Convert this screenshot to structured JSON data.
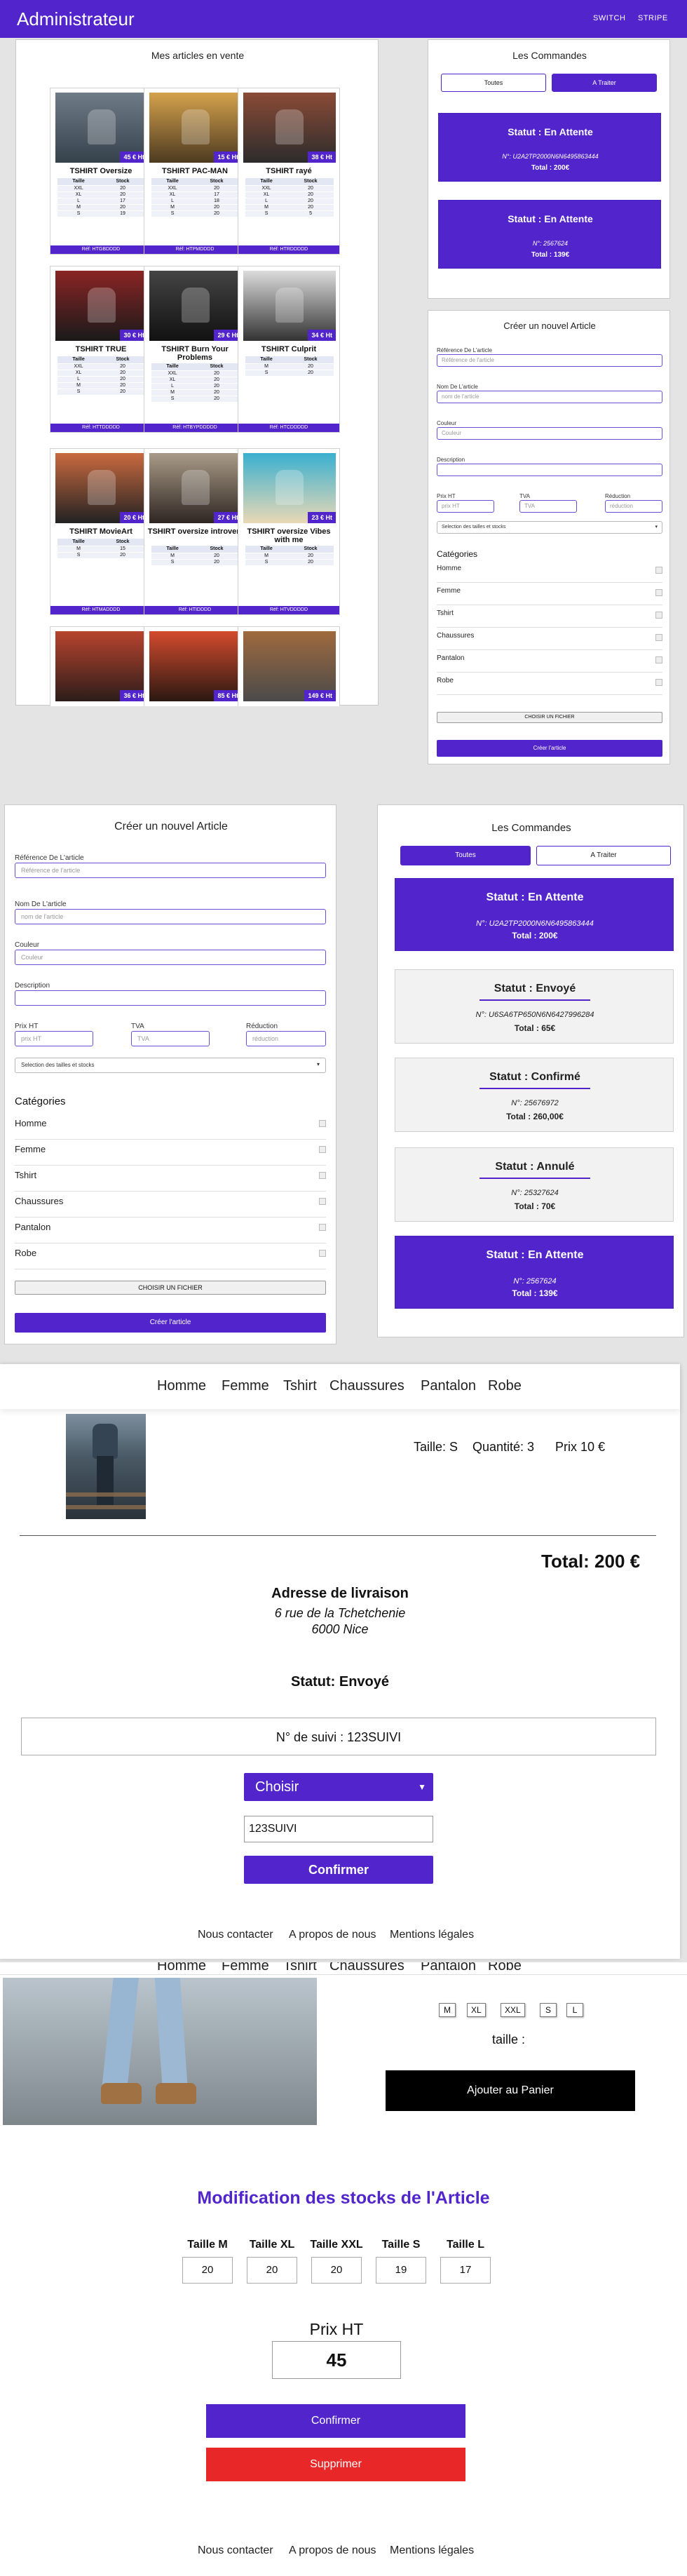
{
  "header": {
    "title": "Administrateur",
    "nav": [
      "SWITCH",
      "STRIPE"
    ],
    "colors": {
      "accent": "#5225cc"
    }
  },
  "articles_panel": {
    "title": "Mes articles en vente",
    "table_headers": [
      "Taille",
      "Stock"
    ],
    "cards": [
      {
        "name": "TSHIRT Oversize",
        "price": "45 € Ht",
        "ref": "Réf: HTGBDDDD",
        "rows": [
          [
            "XXL",
            "20"
          ],
          [
            "XL",
            "20"
          ],
          [
            "L",
            "17"
          ],
          [
            "M",
            "20"
          ],
          [
            "S",
            "19"
          ]
        ]
      },
      {
        "name": "TSHIRT PAC-MAN",
        "price": "15 € Ht",
        "ref": "Réf: HTPMDDDD",
        "rows": [
          [
            "XXL",
            "20"
          ],
          [
            "XL",
            "17"
          ],
          [
            "L",
            "18"
          ],
          [
            "M",
            "20"
          ],
          [
            "S",
            "20"
          ]
        ]
      },
      {
        "name": "TSHIRT rayé",
        "price": "38 € Ht",
        "ref": "Réf: HTRDDDDD",
        "rows": [
          [
            "XXL",
            "20"
          ],
          [
            "XL",
            "20"
          ],
          [
            "L",
            "20"
          ],
          [
            "M",
            "20"
          ],
          [
            "S",
            "5"
          ]
        ]
      },
      {
        "name": "TSHIRT TRUE",
        "price": "30 € Ht",
        "ref": "Réf: HTTDDDDD",
        "rows": [
          [
            "XXL",
            "20"
          ],
          [
            "XL",
            "20"
          ],
          [
            "L",
            "20"
          ],
          [
            "M",
            "20"
          ],
          [
            "S",
            "20"
          ]
        ]
      },
      {
        "name": "TSHIRT Burn Your Problems",
        "price": "29 € Ht",
        "ref": "Réf: HTBYPDDDDD",
        "rows": [
          [
            "XXL",
            "20"
          ],
          [
            "XL",
            "20"
          ],
          [
            "L",
            "20"
          ],
          [
            "M",
            "20"
          ],
          [
            "S",
            "20"
          ]
        ]
      },
      {
        "name": "TSHIRT Culprit",
        "price": "34 € Ht",
        "ref": "Réf: HTCDDDDD",
        "rows": [
          [
            "M",
            "20"
          ],
          [
            "S",
            "20"
          ]
        ]
      },
      {
        "name": "TSHIRT MovieArt",
        "price": "20 € Ht",
        "ref": "Réf: HTMADDDD",
        "rows": [
          [
            "M",
            "15"
          ],
          [
            "S",
            "20"
          ]
        ]
      },
      {
        "name": "TSHIRT oversize introvert",
        "price": "27 € Ht",
        "ref": "Réf: HTIDDDD",
        "rows": [
          [
            "M",
            "20"
          ],
          [
            "S",
            "20"
          ]
        ]
      },
      {
        "name": "TSHIRT oversize Vibes with me",
        "price": "23 € Ht",
        "ref": "Réf: HTVDDDDD",
        "rows": [
          [
            "M",
            "20"
          ],
          [
            "S",
            "20"
          ]
        ]
      }
    ],
    "partial_cards": [
      {
        "price": "36 € Ht"
      },
      {
        "price": "85 € Ht"
      },
      {
        "price": "149 € Ht"
      }
    ]
  },
  "orders": {
    "title": "Les Commandes",
    "tabs": [
      "Toutes",
      "A Traiter"
    ],
    "list_filtered": [
      {
        "status": "Statut : En Attente",
        "number": "N°: U2A2TP2000N6N6495863444",
        "total": "Total : 200€"
      },
      {
        "status": "Statut : En Attente",
        "number": "N°: 2567624",
        "total": "Total : 139€"
      }
    ],
    "list_all": [
      {
        "status": "Statut : En Attente",
        "number": "N°: U2A2TP2000N6N6495863444",
        "total": "Total : 200€",
        "style": "purple"
      },
      {
        "status": "Statut : Envoyé",
        "number": "N°: U6SA6TP650N6N6427996284",
        "total": "Total : 65€",
        "style": "grey"
      },
      {
        "status": "Statut : Confirmé",
        "number": "N°: 25676972",
        "total": "Total : 260,00€",
        "style": "grey"
      },
      {
        "status": "Statut : Annulé",
        "number": "N°: 25327624",
        "total": "Total : 70€",
        "style": "grey"
      },
      {
        "status": "Statut : En Attente",
        "number": "N°: 2567624",
        "total": "Total : 139€",
        "style": "purple"
      }
    ]
  },
  "create_form": {
    "title": "Créer un nouvel Article",
    "ref_label": "Référence De L'article",
    "ref_placeholder": "Référence de l'article",
    "name_label": "Nom De L'article",
    "name_placeholder": "nom de l'article",
    "color_label": "Couleur",
    "color_placeholder": "Couleur",
    "desc_label": "Description",
    "price_label": "Prix HT",
    "price_placeholder": "prix HT",
    "tva_label": "TVA",
    "tva_placeholder": "TVA",
    "discount_label": "Réduction",
    "discount_placeholder": "réduction",
    "sizes_select": "Selection des tailles et stocks",
    "categories_title": "Catégories",
    "categories": [
      "Homme",
      "Femme",
      "Tshirt",
      "Chaussures",
      "Pantalon",
      "Robe"
    ],
    "file_button": "CHOISIR UN FICHIER",
    "submit": "Créer l'article"
  },
  "order_detail": {
    "menu": [
      "Homme",
      "Femme",
      "Tshirt",
      "Chaussures",
      "Pantalon",
      "Robe"
    ],
    "item": {
      "size": "Taille: S",
      "qty": "Quantité: 3",
      "price": "Prix 10 €"
    },
    "total": "Total: 200 €",
    "address_title": "Adresse de livraison",
    "address_line1": "6 rue de la Tchetchenie",
    "address_line2": "6000 Nice",
    "status": "Statut: Envoyé",
    "tracking": "N° de suivi : 123SUIVI",
    "select": "Choisir",
    "tracking_input": "123SUIVI",
    "confirm": "Confirmer"
  },
  "footer": {
    "links": [
      "Nous contacter",
      "A propos de nous",
      "Mentions légales"
    ]
  },
  "stock_edit": {
    "menu": [
      "Homme",
      "Femme",
      "Tshirt",
      "Chaussures",
      "Pantalon",
      "Robe"
    ],
    "size_buttons": [
      "M",
      "XL",
      "XXL",
      "S",
      "L"
    ],
    "size_label": "taille :",
    "add_cart": "Ajouter au Panier",
    "title": "Modification des stocks de l'Article",
    "sizes": [
      {
        "label": "Taille M",
        "value": "20"
      },
      {
        "label": "Taille XL",
        "value": "20"
      },
      {
        "label": "Taille XXL",
        "value": "20"
      },
      {
        "label": "Taille S",
        "value": "19"
      },
      {
        "label": "Taille L",
        "value": "17"
      }
    ],
    "price_label": "Prix HT",
    "price_value": "45",
    "confirm": "Confirmer",
    "delete": "Supprimer"
  }
}
